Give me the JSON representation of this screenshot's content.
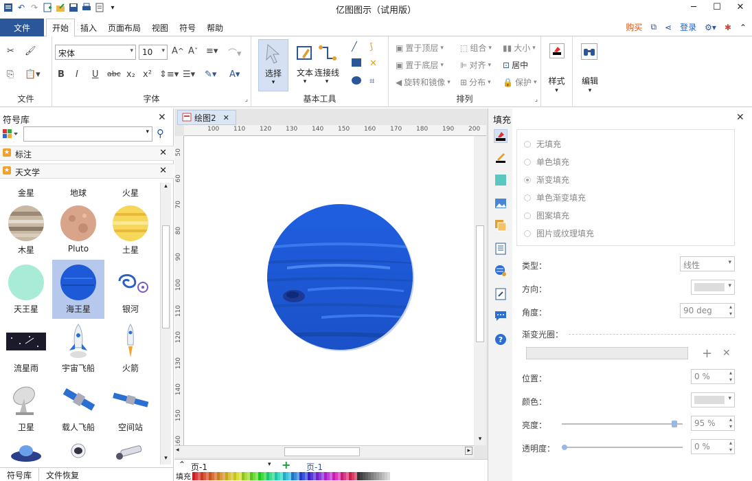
{
  "app": {
    "title": "亿图图示（试用版）"
  },
  "menu": {
    "file": "文件",
    "tabs": [
      "开始",
      "插入",
      "页面布局",
      "视图",
      "符号",
      "帮助"
    ],
    "buy": "购买",
    "login": "登录"
  },
  "ribbon": {
    "groups": {
      "file": "文件",
      "font": "字体",
      "basic_tools": "基本工具",
      "arrange": "排列",
      "style": "样式",
      "edit": "编辑"
    },
    "font_name": "宋体",
    "font_size": "10",
    "tools": {
      "select": "选择",
      "text": "文本",
      "connector": "连接线"
    },
    "arrange": [
      "置于顶层",
      "置于底层",
      "旋转和镜像",
      "组合",
      "对齐",
      "分布",
      "大小",
      "居中",
      "保护"
    ]
  },
  "left_panel": {
    "title": "符号库",
    "categories": [
      "标注",
      "天文学"
    ],
    "shapes_row1_labels": [
      "金星",
      "地球",
      "火星"
    ],
    "shapes": [
      "木星",
      "Pluto",
      "土星",
      "天王星",
      "海王星",
      "银河",
      "流星雨",
      "宇宙飞船",
      "火箭",
      "卫星",
      "载人飞船",
      "空间站"
    ],
    "bottom_tabs": [
      "符号库",
      "文件恢复"
    ]
  },
  "canvas": {
    "doc_tab": "绘图2",
    "hruler": [
      "100",
      "110",
      "120",
      "130",
      "140",
      "150",
      "160",
      "170",
      "180",
      "190",
      "200"
    ],
    "vruler": [
      "50",
      "60",
      "70",
      "80",
      "90",
      "100",
      "110",
      "120",
      "130",
      "140",
      "150",
      "160"
    ],
    "page_select": "页-1",
    "page_tab": "页-1",
    "fill_label": "填充"
  },
  "right_panel": {
    "title": "填充",
    "fill_options": [
      "无填充",
      "单色填充",
      "渐变填充",
      "单色渐变填充",
      "图案填充",
      "图片或纹理填充"
    ],
    "selected_option": "渐变填充",
    "type_label": "类型：",
    "type_value": "线性",
    "direction_label": "方向：",
    "angle_label": "角度：",
    "angle_value": "90 deg",
    "gradient_label": "渐变光圈：",
    "position_label": "位置：",
    "position_value": "0 %",
    "color_label": "颜色：",
    "brightness_label": "亮度：",
    "brightness_value": "95 %",
    "brightness_level": 0.95,
    "transparency_label": "透明度：",
    "transparency_value": "0 %",
    "transparency_level": 0
  },
  "colors": {
    "accent": "#2b579a",
    "neptune": "#1d5ad8",
    "selection": "#b6c9ec"
  }
}
